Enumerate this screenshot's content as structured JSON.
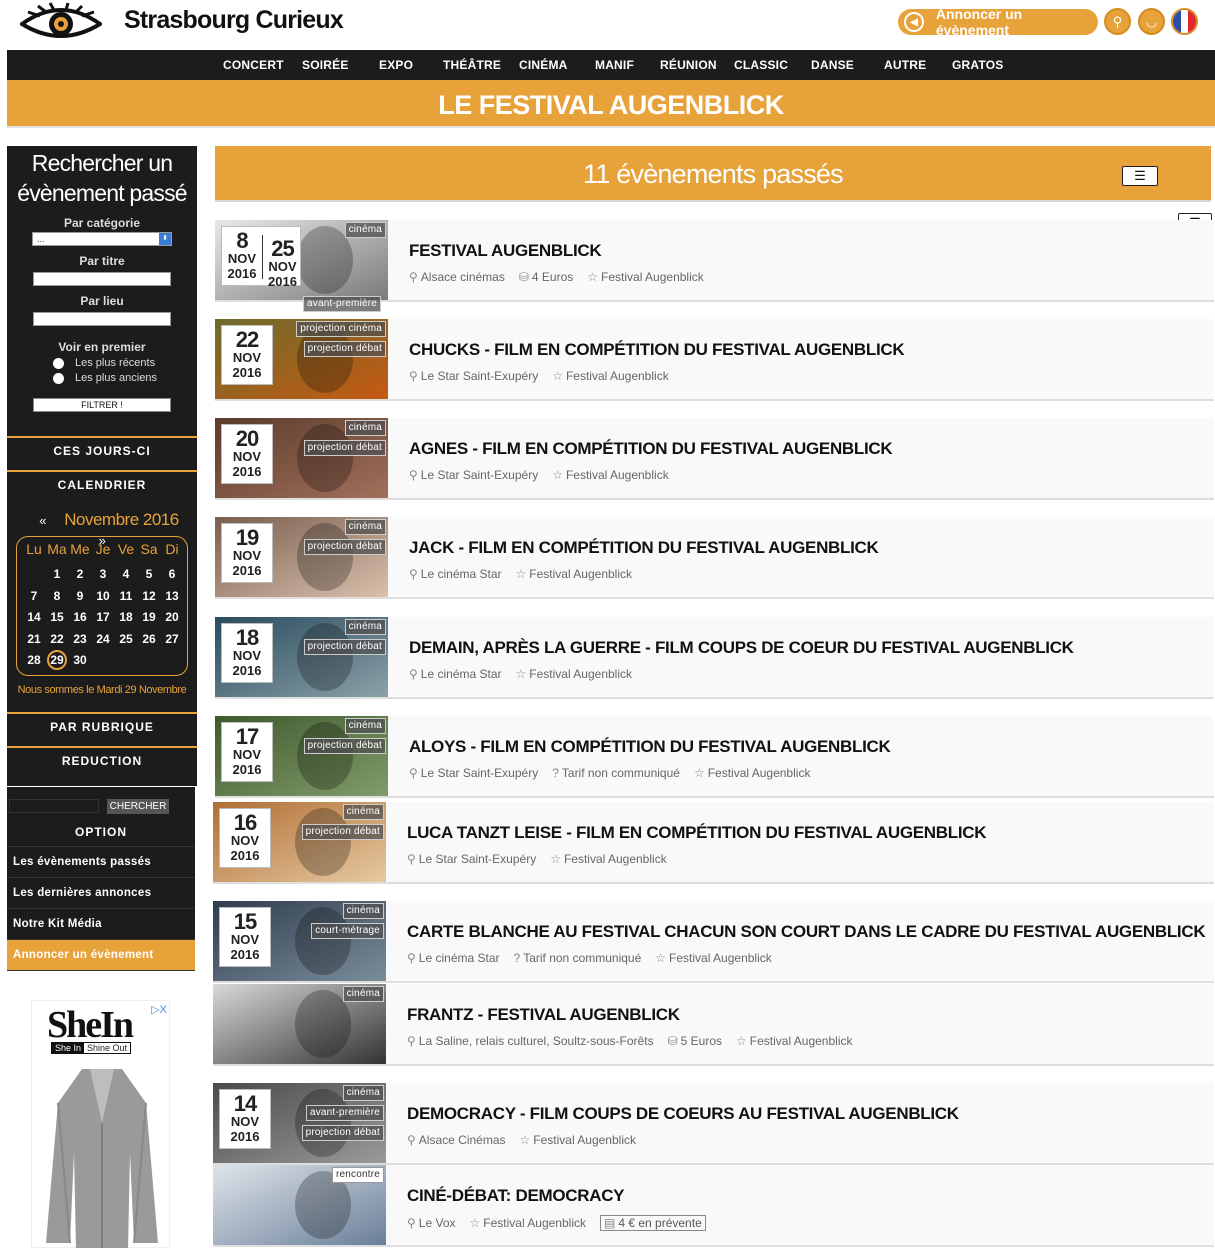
{
  "header": {
    "site_title": "Strasbourg Curieux",
    "announce_label": "Annoncer un évènement"
  },
  "nav": [
    "CONCERT",
    "SOIRÉE",
    "EXPO",
    "THÉÂTRE",
    "CINÉMA",
    "MANIF",
    "RÉUNION",
    "CLASSIC",
    "DANSE",
    "AUTRE",
    "GRATOS"
  ],
  "banner_title": "LE FESTIVAL AUGENBLICK",
  "sidebar": {
    "search_title_line1": "Rechercher un",
    "search_title_line2": "évènement passé",
    "by_category": "Par catégorie",
    "category_value": "...",
    "by_title": "Par titre",
    "by_place": "Par lieu",
    "see_first": "Voir en premier",
    "recent": "Les plus récents",
    "oldest": "Les plus anciens",
    "filter_button": "FILTRER !",
    "these_days": "CES JOURS-CI",
    "calendar": "CALENDRIER",
    "calendar_month": "Novembre 2016",
    "calendar_prev": "«",
    "calendar_next": "»",
    "weekdays": [
      "Lu",
      "Ma",
      "Me",
      "Je",
      "Ve",
      "Sa",
      "Di"
    ],
    "calendar_rows": [
      [
        "",
        "1",
        "2",
        "3",
        "4",
        "5",
        "6"
      ],
      [
        "7",
        "8",
        "9",
        "10",
        "11",
        "12",
        "13"
      ],
      [
        "14",
        "15",
        "16",
        "17",
        "18",
        "19",
        "20"
      ],
      [
        "21",
        "22",
        "23",
        "24",
        "25",
        "26",
        "27"
      ],
      [
        "28",
        "29",
        "30",
        "",
        "",
        "",
        ""
      ]
    ],
    "today": "29",
    "today_note": "Nous sommes le Mardi 29 Novembre",
    "by_section": "PAR RUBRIQUE",
    "reduction": "REDUCTION",
    "search_button": "CHERCHER",
    "option_title": "OPTION",
    "options": [
      "Les évènements passés",
      "Les dernières annonces",
      "Notre Kit Média",
      "Annoncer un évènement"
    ]
  },
  "ad": {
    "brand": "SheIn",
    "tag1": "She In",
    "tag2": "Shine Out",
    "close": "▷X"
  },
  "events_header": "11 évènements passés",
  "events": [
    {
      "day": "8",
      "month": "NOV",
      "year": "2016",
      "day2": "25",
      "month2": "NOV",
      "year2": "2016",
      "tags": [
        "cinéma"
      ],
      "bottom_tag": "avant-première",
      "title": "FESTIVAL AUGENBLICK",
      "place": "Alsace cinémas",
      "price": "4 Euros",
      "organizer": "Festival Augenblick"
    },
    {
      "day": "22",
      "month": "NOV",
      "year": "2016",
      "tags": [
        "projection cinéma",
        "projection débat"
      ],
      "title": "CHUCKS - FILM EN COMPÉTITION DU FESTIVAL AUGENBLICK",
      "place": "Le Star Saint-Exupéry",
      "organizer": "Festival Augenblick"
    },
    {
      "day": "20",
      "month": "NOV",
      "year": "2016",
      "tags": [
        "cinéma",
        "projection débat"
      ],
      "title": "AGNES - FILM EN COMPÉTITION DU FESTIVAL AUGENBLICK",
      "place": "Le Star Saint-Exupéry",
      "organizer": "Festival Augenblick"
    },
    {
      "day": "19",
      "month": "NOV",
      "year": "2016",
      "tags": [
        "cinéma",
        "projection débat"
      ],
      "title": "JACK - FILM EN COMPÉTITION DU FESTIVAL AUGENBLICK",
      "place": "Le cinéma Star",
      "organizer": "Festival Augenblick"
    },
    {
      "day": "18",
      "month": "NOV",
      "year": "2016",
      "tags": [
        "cinéma",
        "projection débat"
      ],
      "title": "DEMAIN, APRÈS LA GUERRE - FILM COUPS DE COEUR DU FESTIVAL AUGENBLICK",
      "place": "Le cinéma Star",
      "organizer": "Festival Augenblick"
    },
    {
      "day": "17",
      "month": "NOV",
      "year": "2016",
      "tags": [
        "cinéma",
        "projection débat"
      ],
      "title": "ALOYS - FILM EN COMPÉTITION DU FESTIVAL AUGENBLICK",
      "place": "Le Star Saint-Exupéry",
      "price": "Tarif non communiqué",
      "organizer": "Festival Augenblick"
    },
    {
      "day": "16",
      "month": "NOV",
      "year": "2016",
      "tags": [
        "cinéma",
        "projection débat"
      ],
      "title": "LUCA TANZT LEISE - FILM EN COMPÉTITION DU FESTIVAL AUGENBLICK",
      "place": "Le Star Saint-Exupéry",
      "organizer": "Festival Augenblick"
    },
    {
      "day": "15",
      "month": "NOV",
      "year": "2016",
      "tags": [
        "cinéma",
        "court-métrage"
      ],
      "title": "CARTE BLANCHE AU FESTIVAL CHACUN SON COURT DANS LE CADRE DU FESTIVAL AUGENBLICK",
      "place": "Le cinéma Star",
      "price": "Tarif non communiqué",
      "organizer": "Festival Augenblick"
    },
    {
      "day": "",
      "month": "",
      "year": "",
      "tags": [
        "cinéma"
      ],
      "title": "FRANTZ - FESTIVAL AUGENBLICK",
      "place": "La Saline, relais culturel, Soultz-sous-Forêts",
      "price": "5 Euros",
      "organizer": "Festival Augenblick"
    },
    {
      "day": "14",
      "month": "NOV",
      "year": "2016",
      "tags": [
        "cinéma",
        "avant-première",
        "projection débat"
      ],
      "title": "DEMOCRACY - FILM COUPS DE COEURS AU FESTIVAL AUGENBLICK",
      "place": "Alsace Cinémas",
      "organizer": "Festival Augenblick"
    },
    {
      "day": "",
      "month": "",
      "year": "",
      "tags": [
        "rencontre"
      ],
      "title": "CINÉ-DÉBAT: DEMOCRACY",
      "place": "Le Vox",
      "organizer": "Festival Augenblick",
      "presale": "4 € en prévente"
    }
  ],
  "colors": {
    "accent": "#e8a23a",
    "dark": "#1c1c1c"
  }
}
